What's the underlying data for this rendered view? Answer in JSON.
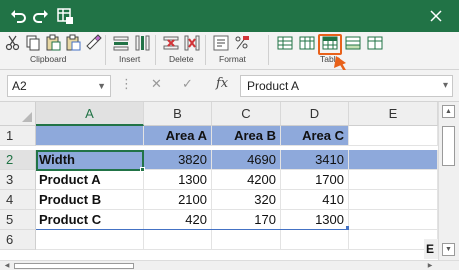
{
  "colors": {
    "title_bar": "#217346",
    "arrow": "#e8611a",
    "table_band": "#8ea9db",
    "table_band_light": "#d9e1f2",
    "table_border": "#4472c4"
  },
  "title_bar": {
    "icons": [
      "undo-icon",
      "redo-icon",
      "quick-table-icon",
      "close-icon"
    ]
  },
  "ribbon": {
    "groups": [
      {
        "label": "Clipboard",
        "icons": [
          "cut-icon",
          "copy-icon",
          "paste-icon",
          "paste-special-icon",
          "format-painter-icon"
        ]
      },
      {
        "label": "Insert",
        "icons": [
          "insert-rows-icon",
          "insert-columns-icon"
        ]
      },
      {
        "label": "Delete",
        "icons": [
          "delete-rows-icon",
          "delete-columns-icon"
        ]
      },
      {
        "label": "Format",
        "icons": [
          "format-cells-icon",
          "format-percent-icon"
        ]
      },
      {
        "label": "Table",
        "icons": [
          "table-rows-icon",
          "table-columns-icon",
          "table-style-icon",
          "table-total-icon",
          "table-sort-icon"
        ]
      }
    ]
  },
  "formula_bar": {
    "name_box": "A2",
    "fx": "fx",
    "cancel": "✕",
    "enter": "✓",
    "value": "Product A"
  },
  "sheet": {
    "columns": [
      "A",
      "B",
      "C",
      "D",
      "E"
    ],
    "selected_column": "A",
    "rows": [
      {
        "num": "1",
        "cells": [
          "",
          "Area A",
          "Area B",
          "Area C",
          ""
        ]
      },
      {
        "num": "2",
        "cells": [
          "Width",
          "3820",
          "4690",
          "3410",
          ""
        ]
      },
      {
        "num": "3",
        "cells": [
          "Product A",
          "1300",
          "4200",
          "1700",
          ""
        ]
      },
      {
        "num": "4",
        "cells": [
          "Product B",
          "2100",
          "320",
          "410",
          ""
        ]
      },
      {
        "num": "5",
        "cells": [
          "Product C",
          "420",
          "170",
          "1300",
          ""
        ]
      },
      {
        "num": "6",
        "cells": [
          "",
          "",
          "",
          "",
          ""
        ]
      }
    ],
    "active_cell": "A2",
    "overflow_cell_text": "E"
  }
}
